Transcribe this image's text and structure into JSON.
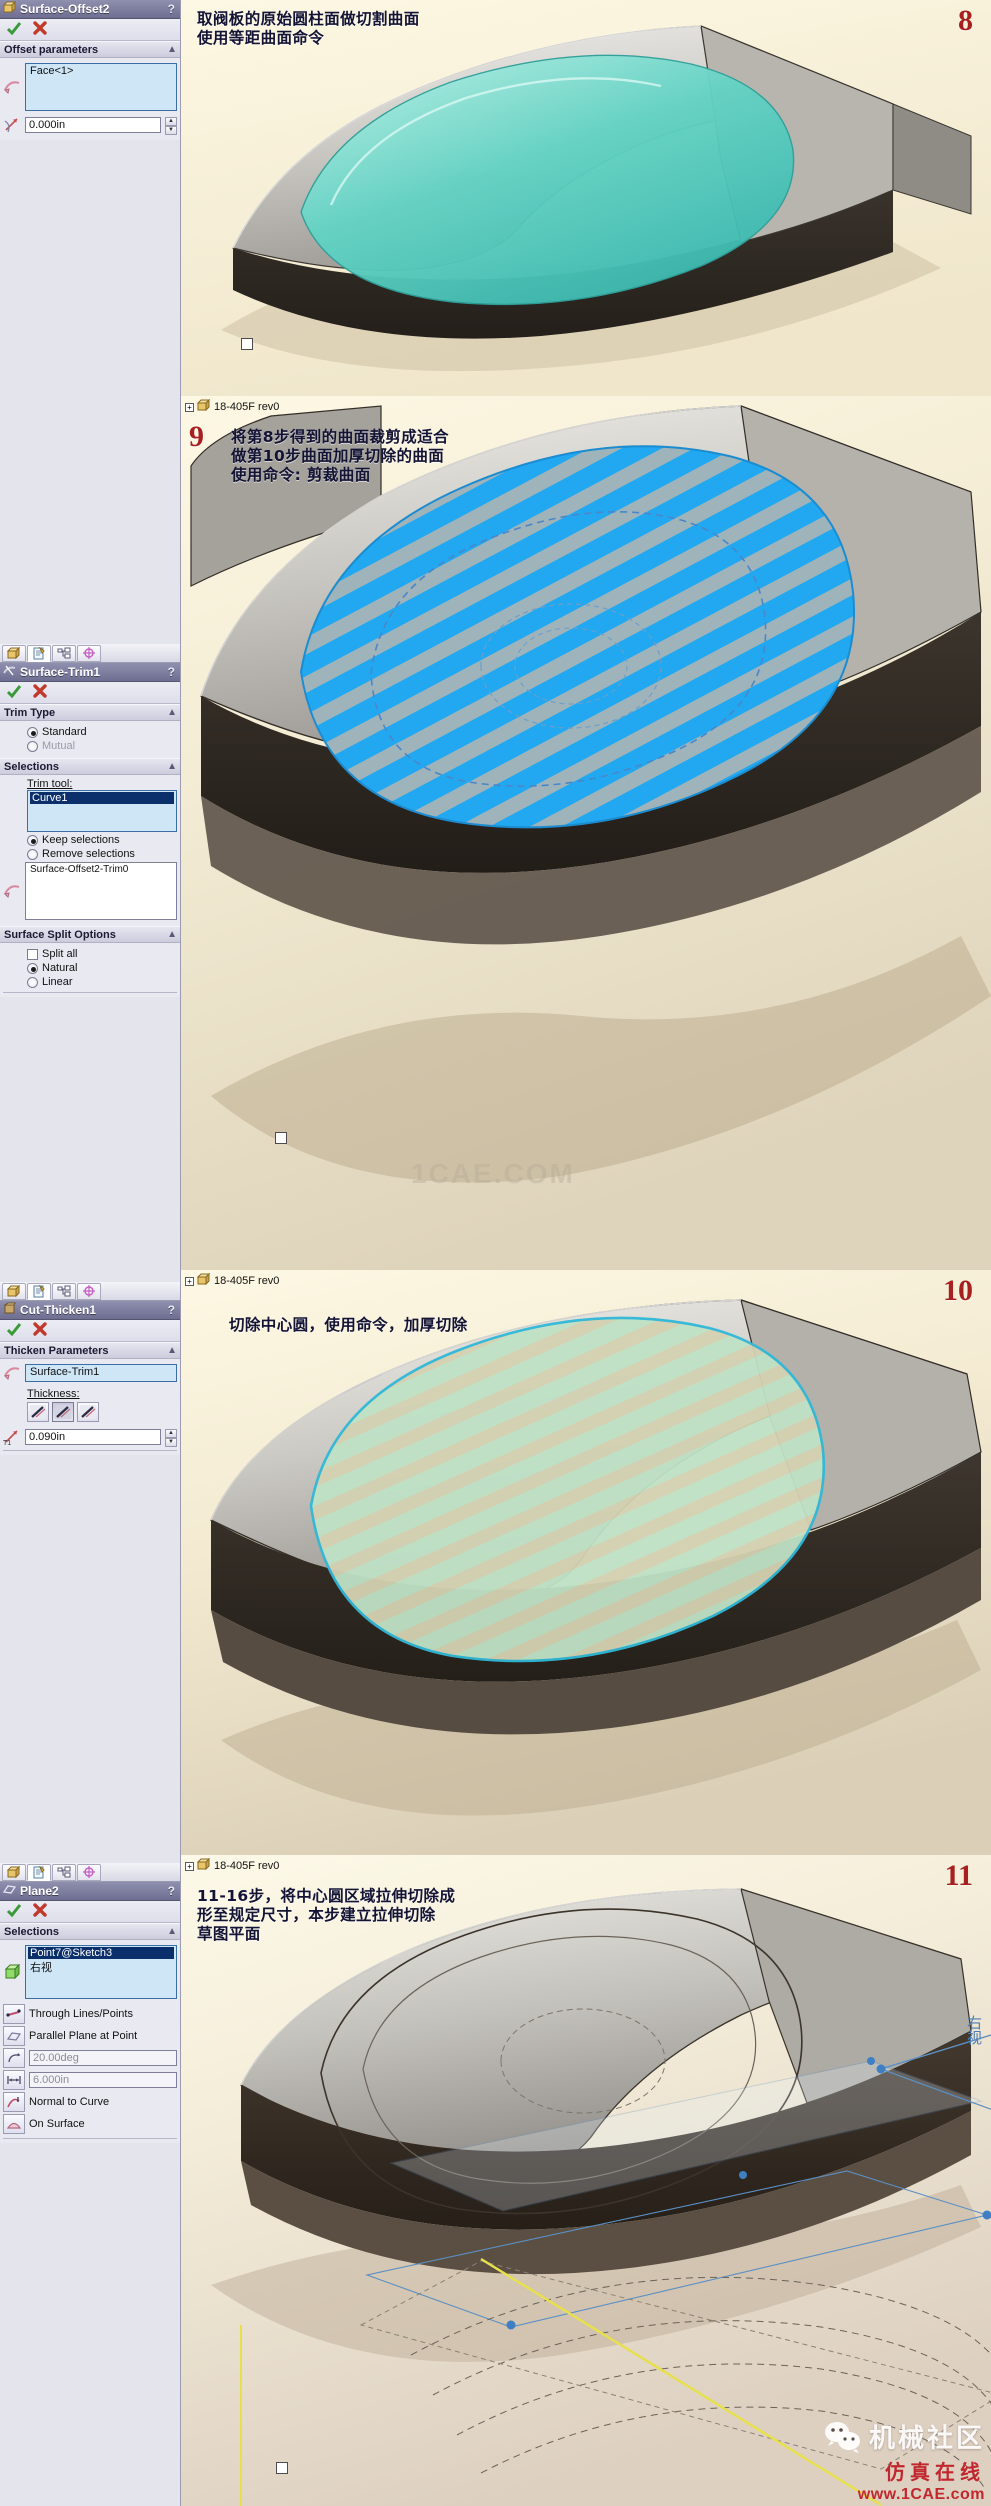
{
  "watermark": {
    "community": "机械社区",
    "sim": "仿真在线",
    "url": "www.1CAE.com",
    "overlay": "1CAE.COM",
    "wechat_icon": "wechat-icon"
  },
  "panels": [
    {
      "id": "panel-8",
      "step": "8",
      "annotation": "取阀板的原始圆柱面做切割曲面\n使用等距曲面命令",
      "model_tree_label": "",
      "propertymanager": {
        "title": "Surface-Offset2",
        "title_icon": "surface-offset-icon",
        "help_glyph": "?",
        "ok_icon": "accept-check-icon",
        "cancel_icon": "cancel-x-icon",
        "tabs": [
          {
            "name": "feature-manager-tab",
            "icon": "feature-tree-icon"
          },
          {
            "name": "property-manager-tab",
            "icon": "property-page-icon"
          },
          {
            "name": "configuration-manager-tab",
            "icon": "configuration-icon"
          },
          {
            "name": "display-manager-tab",
            "icon": "display-manager-icon"
          }
        ],
        "groups": [
          {
            "header": "Offset parameters",
            "face_icon": "face-select-icon",
            "selection_list": [
              "Face<1>"
            ],
            "distance_icon": "offset-distance-icon",
            "distance_value": "0.000in"
          }
        ]
      }
    },
    {
      "id": "panel-9",
      "step": "9",
      "annotation": "将第8步得到的曲面裁剪成适合\n做第10步曲面加厚切除的曲面\n使用命令: 剪裁曲面",
      "model_tree_label": "18-405F rev0",
      "propertymanager": {
        "title": "Surface-Trim1",
        "title_icon": "surface-trim-icon",
        "help_glyph": "?",
        "ok_icon": "accept-check-icon",
        "cancel_icon": "cancel-x-icon",
        "tabs": [
          {
            "name": "feature-manager-tab",
            "icon": "feature-tree-icon"
          },
          {
            "name": "property-manager-tab",
            "icon": "property-page-icon"
          },
          {
            "name": "configuration-manager-tab",
            "icon": "configuration-icon"
          },
          {
            "name": "display-manager-tab",
            "icon": "display-manager-icon"
          }
        ],
        "trim_type": {
          "header": "Trim Type",
          "options": [
            {
              "label": "Standard",
              "selected": true,
              "enabled": true
            },
            {
              "label": "Mutual",
              "selected": false,
              "enabled": false
            }
          ]
        },
        "selections": {
          "header": "Selections",
          "trim_tool_label": "Trim tool:",
          "trim_tool_value": "Curve1",
          "keep_label": "Keep selections",
          "keep_selected": true,
          "remove_label": "Remove selections",
          "remove_selected": false,
          "pieces_list": [
            "Surface-Offset2-Trim0"
          ],
          "face_icon": "face-select-icon"
        },
        "split_options": {
          "header": "Surface Split Options",
          "split_all_label": "Split all",
          "split_all_checked": false,
          "natural_label": "Natural",
          "natural_selected": true,
          "linear_label": "Linear",
          "linear_selected": false
        }
      }
    },
    {
      "id": "panel-10",
      "step": "10",
      "annotation": "切除中心圆，使用命令，加厚切除",
      "model_tree_label": "18-405F rev0",
      "propertymanager": {
        "title": "Cut-Thicken1",
        "title_icon": "cut-thicken-icon",
        "help_glyph": "?",
        "ok_icon": "accept-check-icon",
        "cancel_icon": "cancel-x-icon",
        "tabs": [
          {
            "name": "feature-manager-tab",
            "icon": "feature-tree-icon"
          },
          {
            "name": "property-manager-tab",
            "icon": "property-page-icon"
          },
          {
            "name": "configuration-manager-tab",
            "icon": "configuration-icon"
          },
          {
            "name": "display-manager-tab",
            "icon": "display-manager-icon"
          }
        ],
        "thicken": {
          "header": "Thicken Parameters",
          "surface_icon": "surface-select-icon",
          "surface_value": "Surface-Trim1",
          "thickness_label": "Thickness:",
          "side_buttons": [
            {
              "name": "thicken-side-one-button",
              "icon": "thicken-side1-icon",
              "pressed": false
            },
            {
              "name": "thicken-side-two-button",
              "icon": "thicken-side2-icon",
              "pressed": true
            },
            {
              "name": "thicken-both-sides-button",
              "icon": "thicken-both-icon",
              "pressed": false
            }
          ],
          "thickness_icon": "thickness-dim-icon",
          "thickness_value": "0.090in"
        }
      }
    },
    {
      "id": "panel-11",
      "step": "11",
      "annotation": "11-16步，将中心圆区域拉伸切除成\n形至规定尺寸，本步建立拉伸切除\n草图平面",
      "model_tree_label": "18-405F rev0",
      "right_note": "右视",
      "propertymanager": {
        "title": "Plane2",
        "title_icon": "plane-icon",
        "help_glyph": "?",
        "ok_icon": "accept-check-icon",
        "cancel_icon": "cancel-x-icon",
        "tabs": [
          {
            "name": "feature-manager-tab",
            "icon": "feature-tree-icon"
          },
          {
            "name": "property-manager-tab",
            "icon": "property-page-icon"
          },
          {
            "name": "configuration-manager-tab",
            "icon": "configuration-icon"
          },
          {
            "name": "display-manager-tab",
            "icon": "display-manager-icon"
          }
        ],
        "selections": {
          "header": "Selections",
          "ref_icon": "reference-entities-icon",
          "items": [
            "Point7@Sketch3",
            "右视"
          ],
          "constraints": [
            {
              "label": "Through Lines/Points",
              "icon": "through-lines-points-icon"
            },
            {
              "label": "Parallel Plane at Point",
              "icon": "parallel-plane-point-icon"
            },
            {
              "label": "",
              "icon": "angle-icon",
              "value": "20.00deg",
              "dim": true
            },
            {
              "label": "",
              "icon": "offset-distance-icon",
              "value": "6.000in",
              "dim": true
            },
            {
              "label": "Normal to Curve",
              "icon": "normal-to-curve-icon"
            },
            {
              "label": "On Surface",
              "icon": "on-surface-icon"
            }
          ]
        }
      }
    }
  ]
}
